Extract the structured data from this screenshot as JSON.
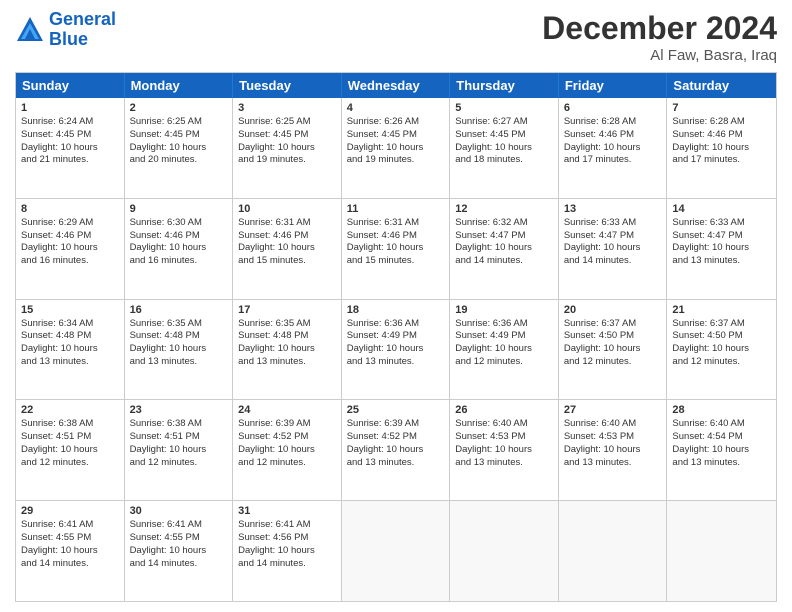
{
  "header": {
    "logo_line1": "General",
    "logo_line2": "Blue",
    "title": "December 2024",
    "subtitle": "Al Faw, Basra, Iraq"
  },
  "calendar": {
    "days_of_week": [
      "Sunday",
      "Monday",
      "Tuesday",
      "Wednesday",
      "Thursday",
      "Friday",
      "Saturday"
    ],
    "weeks": [
      [
        {
          "num": "",
          "content": "",
          "empty": true
        },
        {
          "num": "",
          "content": "",
          "empty": true
        },
        {
          "num": "",
          "content": "",
          "empty": true
        },
        {
          "num": "",
          "content": "",
          "empty": true
        },
        {
          "num": "",
          "content": "",
          "empty": true
        },
        {
          "num": "",
          "content": "",
          "empty": true
        },
        {
          "num": "",
          "content": "",
          "empty": true
        }
      ],
      [
        {
          "num": "1",
          "lines": [
            "Sunrise: 6:24 AM",
            "Sunset: 4:45 PM",
            "Daylight: 10 hours",
            "and 21 minutes."
          ]
        },
        {
          "num": "2",
          "lines": [
            "Sunrise: 6:25 AM",
            "Sunset: 4:45 PM",
            "Daylight: 10 hours",
            "and 20 minutes."
          ]
        },
        {
          "num": "3",
          "lines": [
            "Sunrise: 6:25 AM",
            "Sunset: 4:45 PM",
            "Daylight: 10 hours",
            "and 19 minutes."
          ]
        },
        {
          "num": "4",
          "lines": [
            "Sunrise: 6:26 AM",
            "Sunset: 4:45 PM",
            "Daylight: 10 hours",
            "and 19 minutes."
          ]
        },
        {
          "num": "5",
          "lines": [
            "Sunrise: 6:27 AM",
            "Sunset: 4:45 PM",
            "Daylight: 10 hours",
            "and 18 minutes."
          ]
        },
        {
          "num": "6",
          "lines": [
            "Sunrise: 6:28 AM",
            "Sunset: 4:46 PM",
            "Daylight: 10 hours",
            "and 17 minutes."
          ]
        },
        {
          "num": "7",
          "lines": [
            "Sunrise: 6:28 AM",
            "Sunset: 4:46 PM",
            "Daylight: 10 hours",
            "and 17 minutes."
          ]
        }
      ],
      [
        {
          "num": "8",
          "lines": [
            "Sunrise: 6:29 AM",
            "Sunset: 4:46 PM",
            "Daylight: 10 hours",
            "and 16 minutes."
          ]
        },
        {
          "num": "9",
          "lines": [
            "Sunrise: 6:30 AM",
            "Sunset: 4:46 PM",
            "Daylight: 10 hours",
            "and 16 minutes."
          ]
        },
        {
          "num": "10",
          "lines": [
            "Sunrise: 6:31 AM",
            "Sunset: 4:46 PM",
            "Daylight: 10 hours",
            "and 15 minutes."
          ]
        },
        {
          "num": "11",
          "lines": [
            "Sunrise: 6:31 AM",
            "Sunset: 4:46 PM",
            "Daylight: 10 hours",
            "and 15 minutes."
          ]
        },
        {
          "num": "12",
          "lines": [
            "Sunrise: 6:32 AM",
            "Sunset: 4:47 PM",
            "Daylight: 10 hours",
            "and 14 minutes."
          ]
        },
        {
          "num": "13",
          "lines": [
            "Sunrise: 6:33 AM",
            "Sunset: 4:47 PM",
            "Daylight: 10 hours",
            "and 14 minutes."
          ]
        },
        {
          "num": "14",
          "lines": [
            "Sunrise: 6:33 AM",
            "Sunset: 4:47 PM",
            "Daylight: 10 hours",
            "and 13 minutes."
          ]
        }
      ],
      [
        {
          "num": "15",
          "lines": [
            "Sunrise: 6:34 AM",
            "Sunset: 4:48 PM",
            "Daylight: 10 hours",
            "and 13 minutes."
          ]
        },
        {
          "num": "16",
          "lines": [
            "Sunrise: 6:35 AM",
            "Sunset: 4:48 PM",
            "Daylight: 10 hours",
            "and 13 minutes."
          ]
        },
        {
          "num": "17",
          "lines": [
            "Sunrise: 6:35 AM",
            "Sunset: 4:48 PM",
            "Daylight: 10 hours",
            "and 13 minutes."
          ]
        },
        {
          "num": "18",
          "lines": [
            "Sunrise: 6:36 AM",
            "Sunset: 4:49 PM",
            "Daylight: 10 hours",
            "and 13 minutes."
          ]
        },
        {
          "num": "19",
          "lines": [
            "Sunrise: 6:36 AM",
            "Sunset: 4:49 PM",
            "Daylight: 10 hours",
            "and 12 minutes."
          ]
        },
        {
          "num": "20",
          "lines": [
            "Sunrise: 6:37 AM",
            "Sunset: 4:50 PM",
            "Daylight: 10 hours",
            "and 12 minutes."
          ]
        },
        {
          "num": "21",
          "lines": [
            "Sunrise: 6:37 AM",
            "Sunset: 4:50 PM",
            "Daylight: 10 hours",
            "and 12 minutes."
          ]
        }
      ],
      [
        {
          "num": "22",
          "lines": [
            "Sunrise: 6:38 AM",
            "Sunset: 4:51 PM",
            "Daylight: 10 hours",
            "and 12 minutes."
          ]
        },
        {
          "num": "23",
          "lines": [
            "Sunrise: 6:38 AM",
            "Sunset: 4:51 PM",
            "Daylight: 10 hours",
            "and 12 minutes."
          ]
        },
        {
          "num": "24",
          "lines": [
            "Sunrise: 6:39 AM",
            "Sunset: 4:52 PM",
            "Daylight: 10 hours",
            "and 12 minutes."
          ]
        },
        {
          "num": "25",
          "lines": [
            "Sunrise: 6:39 AM",
            "Sunset: 4:52 PM",
            "Daylight: 10 hours",
            "and 13 minutes."
          ]
        },
        {
          "num": "26",
          "lines": [
            "Sunrise: 6:40 AM",
            "Sunset: 4:53 PM",
            "Daylight: 10 hours",
            "and 13 minutes."
          ]
        },
        {
          "num": "27",
          "lines": [
            "Sunrise: 6:40 AM",
            "Sunset: 4:53 PM",
            "Daylight: 10 hours",
            "and 13 minutes."
          ]
        },
        {
          "num": "28",
          "lines": [
            "Sunrise: 6:40 AM",
            "Sunset: 4:54 PM",
            "Daylight: 10 hours",
            "and 13 minutes."
          ]
        }
      ],
      [
        {
          "num": "29",
          "lines": [
            "Sunrise: 6:41 AM",
            "Sunset: 4:55 PM",
            "Daylight: 10 hours",
            "and 14 minutes."
          ]
        },
        {
          "num": "30",
          "lines": [
            "Sunrise: 6:41 AM",
            "Sunset: 4:55 PM",
            "Daylight: 10 hours",
            "and 14 minutes."
          ]
        },
        {
          "num": "31",
          "lines": [
            "Sunrise: 6:41 AM",
            "Sunset: 4:56 PM",
            "Daylight: 10 hours",
            "and 14 minutes."
          ]
        },
        {
          "num": "",
          "content": "",
          "empty": true
        },
        {
          "num": "",
          "content": "",
          "empty": true
        },
        {
          "num": "",
          "content": "",
          "empty": true
        },
        {
          "num": "",
          "content": "",
          "empty": true
        }
      ]
    ]
  }
}
